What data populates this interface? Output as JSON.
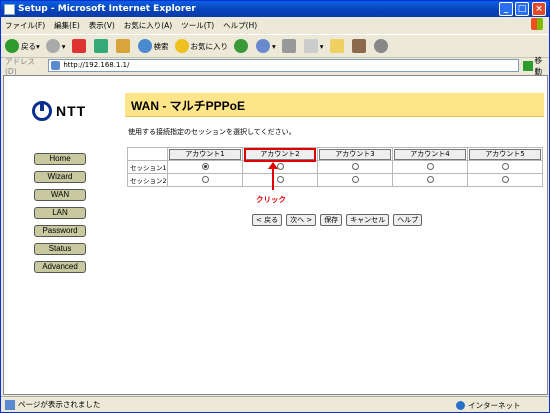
{
  "window": {
    "title": "Setup - Microsoft Internet Explorer",
    "min": "_",
    "max": "□",
    "close": "×"
  },
  "menu": [
    "ファイル(F)",
    "編集(E)",
    "表示(V)",
    "お気に入り(A)",
    "ツール(T)",
    "ヘルプ(H)"
  ],
  "toolbar": {
    "back": "戻る",
    "search": "検索",
    "favorites": "お気に入り"
  },
  "address": {
    "label": "アドレス(D)",
    "url": "http://192.168.1.1/",
    "go": "移動"
  },
  "logo": "NTT",
  "nav": [
    "Home",
    "Wizard",
    "WAN",
    "LAN",
    "Password",
    "Status",
    "Advanced"
  ],
  "page": {
    "title": "WAN - マルチPPPoE",
    "instruction": "使用する接続指定のセッションを選択してください。"
  },
  "table": {
    "accounts": [
      "アカウント1",
      "アカウント2",
      "アカウント3",
      "アカウント4",
      "アカウント5"
    ],
    "sessions": [
      "セッション1",
      "セッション2"
    ],
    "selected": {
      "session": 1,
      "account": 1
    }
  },
  "annotation": {
    "click": "クリック",
    "highlight_color": "#e00000"
  },
  "actions": [
    "< 戻る",
    "次へ >",
    "保存",
    "キャンセル",
    "ヘルプ"
  ],
  "status": {
    "text": "ページが表示されました",
    "zone": "インターネット"
  }
}
